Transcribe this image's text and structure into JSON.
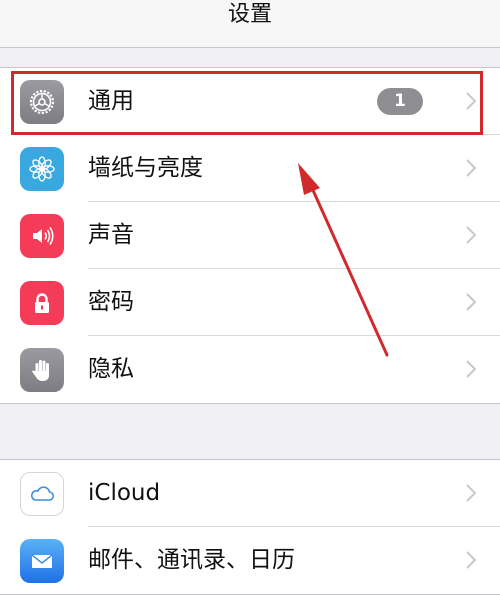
{
  "navbar": {
    "title": "设置"
  },
  "groups": [
    {
      "items": [
        {
          "label": "通用",
          "icon": "gear-icon",
          "badge": "1",
          "color": "#8e8e93"
        },
        {
          "label": "墙纸与亮度",
          "icon": "flower-icon",
          "color": "#39a8e0"
        },
        {
          "label": "声音",
          "icon": "speaker-icon",
          "color": "#f43b57"
        },
        {
          "label": "密码",
          "icon": "lock-icon",
          "color": "#f43b57"
        },
        {
          "label": "隐私",
          "icon": "hand-icon",
          "color": "#8e8e93"
        }
      ]
    },
    {
      "items": [
        {
          "label": "iCloud",
          "icon": "cloud-icon",
          "color": "#ffffff"
        },
        {
          "label": "邮件、通讯录、日历",
          "icon": "mail-icon",
          "color": "#3b8ef0"
        }
      ]
    }
  ],
  "annotation": {
    "highlight_color": "#d1292c"
  }
}
